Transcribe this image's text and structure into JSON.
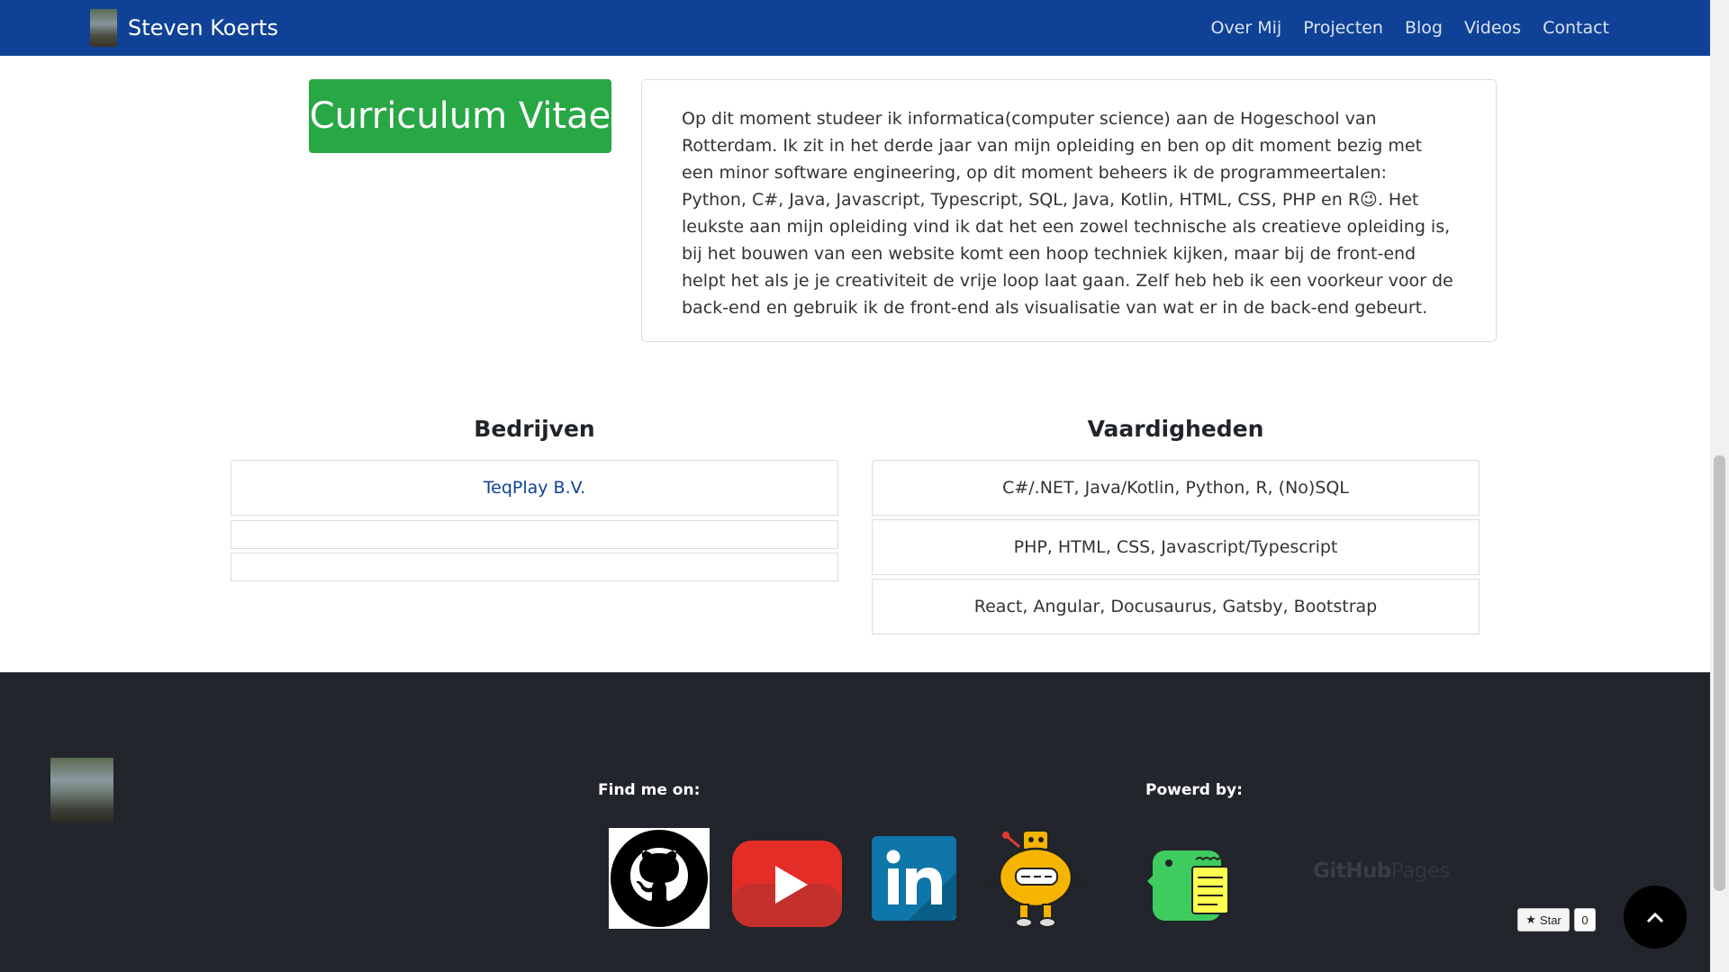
{
  "navbar": {
    "brand": "Steven Koerts",
    "links": [
      "Over Mij",
      "Projecten",
      "Blog",
      "Videos",
      "Contact"
    ]
  },
  "cv": {
    "title": "Curriculum Vitae",
    "about": "Op dit moment studeer ik informatica(computer science) aan de Hogeschool van Rotterdam. Ik zit in het derde jaar van mijn opleiding en ben op dit moment bezig met een minor software engineering, op dit moment beheers ik de programmeertalen: Python, C#, Java, Javascript, Typescript, SQL, Java, Kotlin, HTML, CSS, PHP en R😉. Het leukste aan mijn opleiding vind ik dat het een zowel technische als creatieve opleiding is, bij het bouwen van een website komt een hoop techniek kijken, maar bij de front-end helpt het als je je creativiteit de vrije loop laat gaan. Zelf heb heb ik een voorkeur voor de back-end en gebruik ik de front-end als visualisatie van wat er in de back-end gebeurt."
  },
  "companies": {
    "title": "Bedrijven",
    "items": [
      "TeqPlay B.V.",
      "",
      ""
    ]
  },
  "skills": {
    "title": "Vaardigheden",
    "items": [
      "C#/.NET, Java/Kotlin, Python, R, (No)SQL",
      "PHP, HTML, CSS, Javascript/Typescript",
      "React, Angular, Docusaurus, Gatsby, Bootstrap"
    ]
  },
  "footer": {
    "find_me": "Find me on:",
    "powered_by": "Powerd by:",
    "github_pages": {
      "bold": "GitHub",
      "light": "Pages"
    },
    "star_label": "Star",
    "star_count": "0",
    "socials": [
      "github-icon",
      "youtube-icon",
      "linkedin-icon",
      "robot-icon"
    ],
    "powered": [
      "docusaurus-icon",
      "github-pages-logo"
    ]
  },
  "colors": {
    "navbar": "#0f4296",
    "cv_button": "#28a745",
    "footer": "#22252b",
    "link": "#0f4296"
  }
}
